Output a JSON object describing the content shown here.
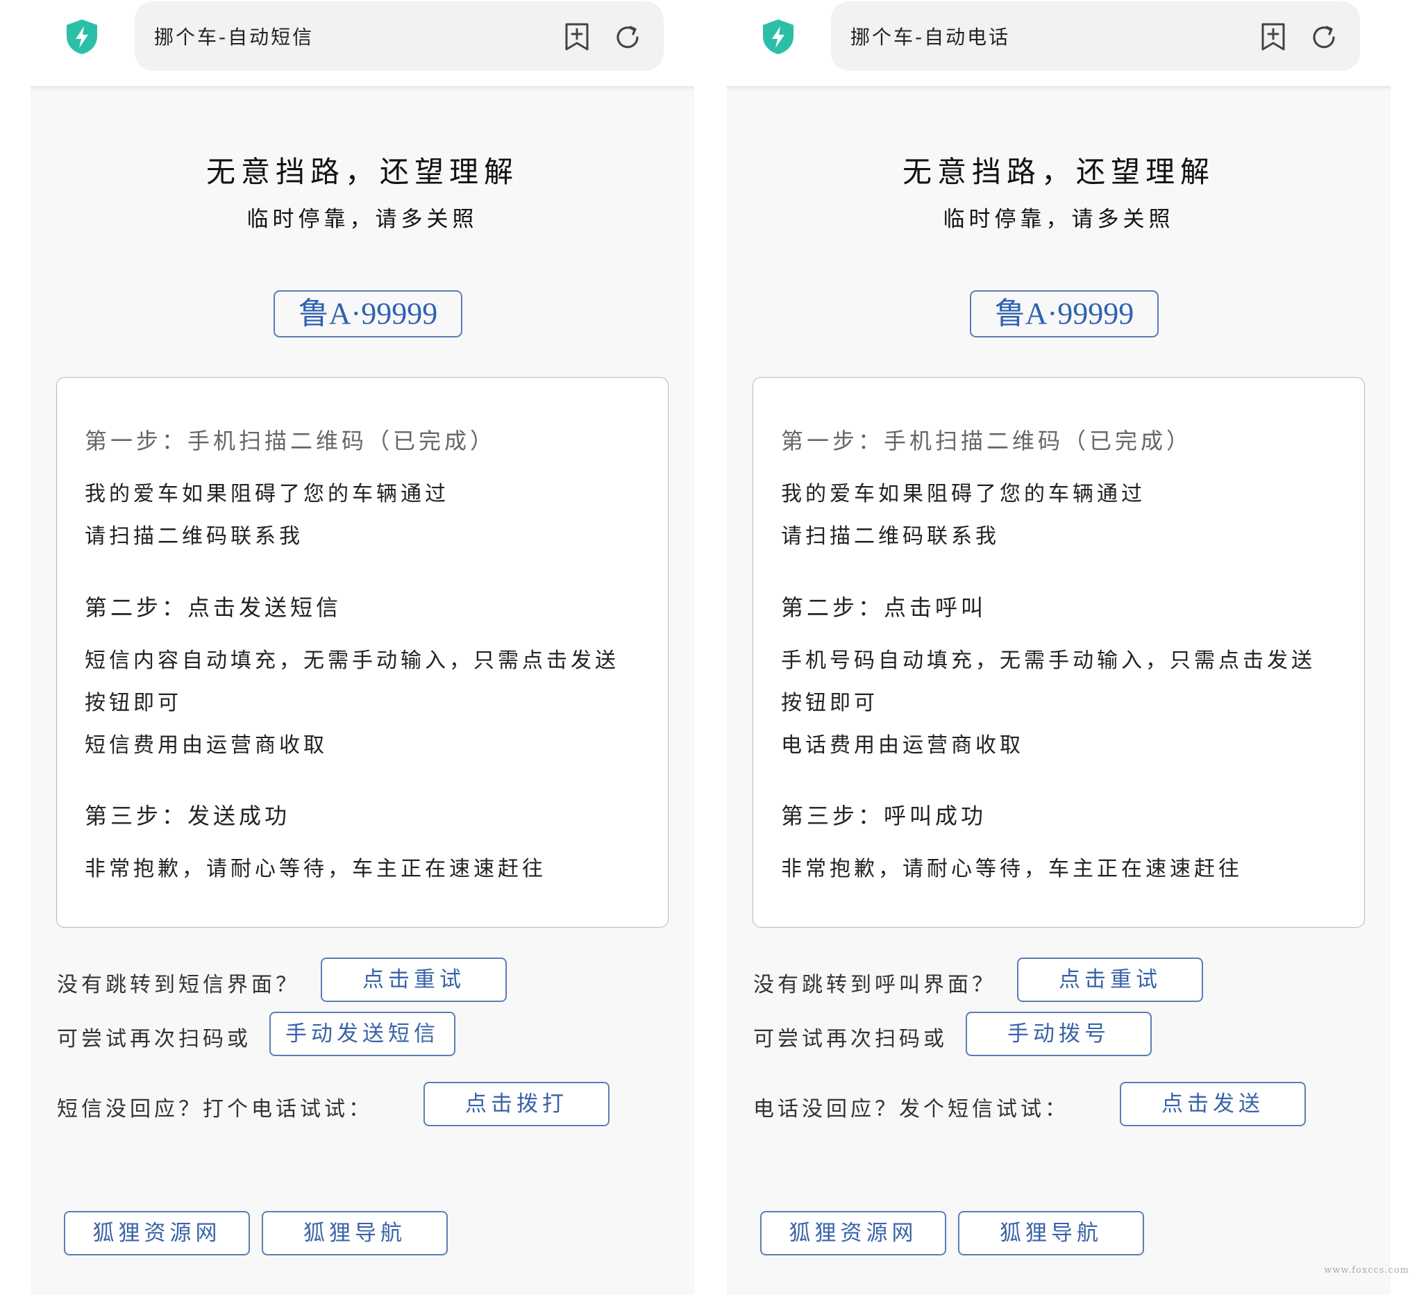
{
  "colors": {
    "accent": "#5a7db5",
    "shield": "#2cbfa8",
    "bg": "#f8f8f9"
  },
  "panels": [
    {
      "tab_title": "挪个车-自动短信",
      "headline": "无意挡路，还望理解",
      "subline": "临时停靠，请多关照",
      "plate": "鲁A·99999",
      "steps": {
        "s1_title": "第一步：手机扫描二维码（已完成）",
        "s1_l1": "我的爱车如果阻碍了您的车辆通过",
        "s1_l2": "请扫描二维码联系我",
        "s2_title": "第二步：点击发送短信",
        "s2_l1": "短信内容自动填充，无需手动输入，只需点击发送",
        "s2_l2": "按钮即可",
        "s2_l3": "短信费用由运营商收取",
        "s3_title": "第三步：发送成功",
        "s3_l1": "非常抱歉，请耐心等待，车主正在速速赶往"
      },
      "actions": {
        "r1_label": "没有跳转到短信界面？",
        "r1_btn": "点击重试",
        "r2_label": "可尝试再次扫码或",
        "r2_btn": "手动发送短信",
        "r3_label": "短信没回应？打个电话试试：",
        "r3_btn": "点击拨打"
      },
      "footer": {
        "link1": "狐狸资源网",
        "link2": "狐狸导航"
      }
    },
    {
      "tab_title": "挪个车-自动电话",
      "headline": "无意挡路，还望理解",
      "subline": "临时停靠，请多关照",
      "plate": "鲁A·99999",
      "steps": {
        "s1_title": "第一步：手机扫描二维码（已完成）",
        "s1_l1": "我的爱车如果阻碍了您的车辆通过",
        "s1_l2": "请扫描二维码联系我",
        "s2_title": "第二步：点击呼叫",
        "s2_l1": "手机号码自动填充，无需手动输入，只需点击发送",
        "s2_l2": "按钮即可",
        "s2_l3": "电话费用由运营商收取",
        "s3_title": "第三步：呼叫成功",
        "s3_l1": "非常抱歉，请耐心等待，车主正在速速赶往"
      },
      "actions": {
        "r1_label": "没有跳转到呼叫界面？",
        "r1_btn": "点击重试",
        "r2_label": "可尝试再次扫码或",
        "r2_btn": "手动拨号",
        "r3_label": "电话没回应？发个短信试试：",
        "r3_btn": "点击发送"
      },
      "footer": {
        "link1": "狐狸资源网",
        "link2": "狐狸导航"
      }
    }
  ],
  "watermark": "www.foxccs.com"
}
